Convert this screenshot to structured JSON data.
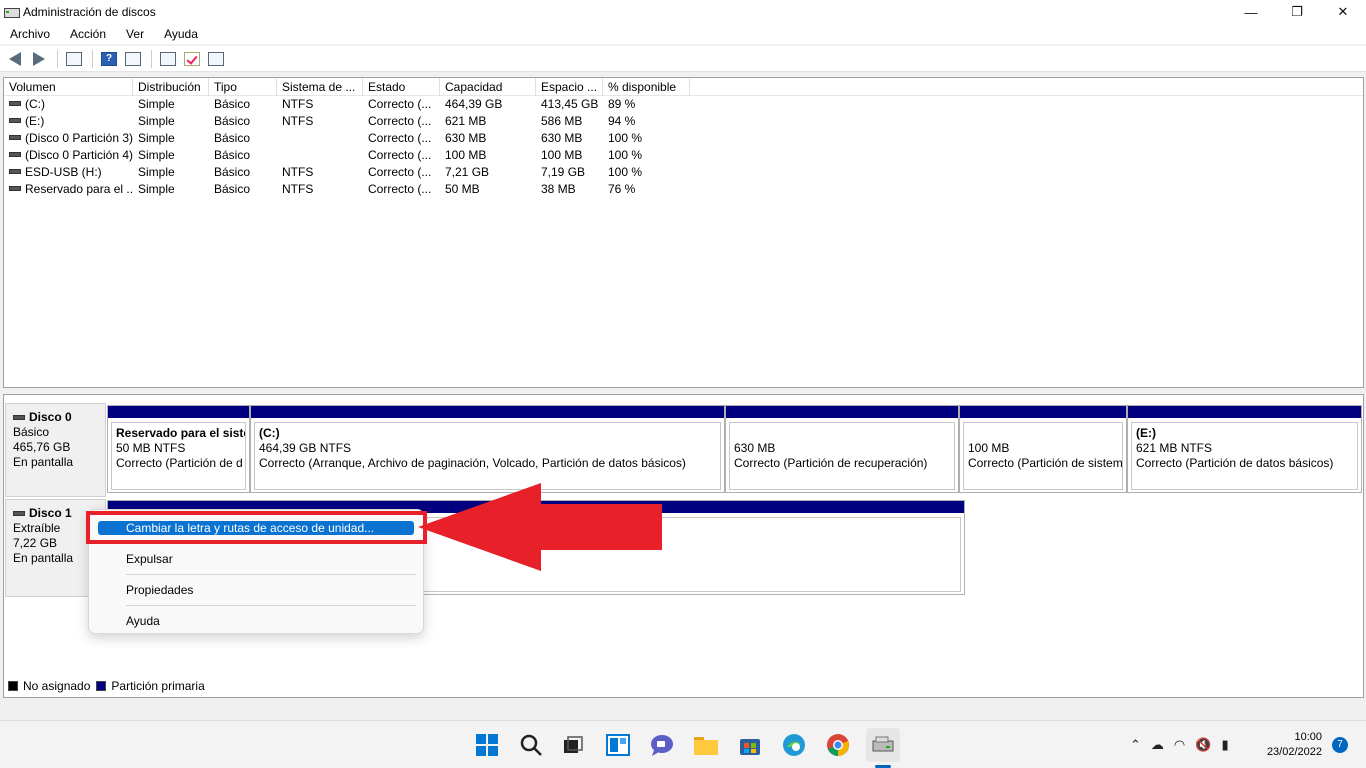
{
  "window": {
    "title": "Administración de discos"
  },
  "menu": [
    "Archivo",
    "Acción",
    "Ver",
    "Ayuda"
  ],
  "volume_table": {
    "headers": [
      "Volumen",
      "Distribución",
      "Tipo",
      "Sistema de ...",
      "Estado",
      "Capacidad",
      "Espacio ...",
      "% disponible"
    ],
    "rows": [
      [
        "(C:)",
        "Simple",
        "Básico",
        "NTFS",
        "Correcto (...",
        "464,39 GB",
        "413,45 GB",
        "89 %"
      ],
      [
        "(E:)",
        "Simple",
        "Básico",
        "NTFS",
        "Correcto (...",
        "621 MB",
        "586 MB",
        "94 %"
      ],
      [
        "(Disco 0 Partición 3)",
        "Simple",
        "Básico",
        "",
        "Correcto (...",
        "630 MB",
        "630 MB",
        "100 %"
      ],
      [
        "(Disco 0 Partición 4)",
        "Simple",
        "Básico",
        "",
        "Correcto (...",
        "100 MB",
        "100 MB",
        "100 %"
      ],
      [
        "ESD-USB (H:)",
        "Simple",
        "Básico",
        "NTFS",
        "Correcto (...",
        "7,21 GB",
        "7,19 GB",
        "100 %"
      ],
      [
        "Reservado para el ...",
        "Simple",
        "Básico",
        "NTFS",
        "Correcto (...",
        "50 MB",
        "38 MB",
        "76 %"
      ]
    ]
  },
  "disks": [
    {
      "name": "Disco 0",
      "type": "Básico",
      "size": "465,76 GB",
      "status": "En pantalla",
      "partitions": [
        {
          "name": "Reservado para el siste",
          "size": "50 MB NTFS",
          "status": "Correcto (Partición de d"
        },
        {
          "name": "(C:)",
          "size": "464,39 GB NTFS",
          "status": "Correcto (Arranque, Archivo de paginación, Volcado, Partición de datos básicos)"
        },
        {
          "name": "",
          "size": "630 MB",
          "status": "Correcto (Partición de recuperación)"
        },
        {
          "name": "",
          "size": "100 MB",
          "status": "Correcto (Partición de sistem"
        },
        {
          "name": "(E:)",
          "size": "621 MB NTFS",
          "status": "Correcto (Partición de datos básicos)"
        }
      ]
    },
    {
      "name": "Disco 1",
      "type": "Extraíble",
      "size": "7,22 GB",
      "status": "En pantalla"
    }
  ],
  "context_menu": {
    "items": [
      "Cambiar la letra y rutas de acceso de unidad...",
      "Expulsar",
      "Propiedades",
      "Ayuda"
    ],
    "highlighted": "Cambiar la letra y rutas de acceso de unidad..."
  },
  "legend": [
    {
      "label": "No asignado",
      "color": "#000000"
    },
    {
      "label": "Partición primaria",
      "color": "#000080"
    }
  ],
  "taskbar": {
    "apps": [
      "start-icon",
      "search-icon",
      "task-view-icon",
      "widgets-icon",
      "chat-icon",
      "file-explorer-icon",
      "store-icon",
      "edge-icon",
      "chrome-icon",
      "disk-management-icon"
    ],
    "time": "10:00",
    "date": "23/02/2022",
    "notifications": "7"
  },
  "colors": {
    "primary_partition": "#000080",
    "highlight": "#0a72d1",
    "annotation": "#e8202a"
  }
}
